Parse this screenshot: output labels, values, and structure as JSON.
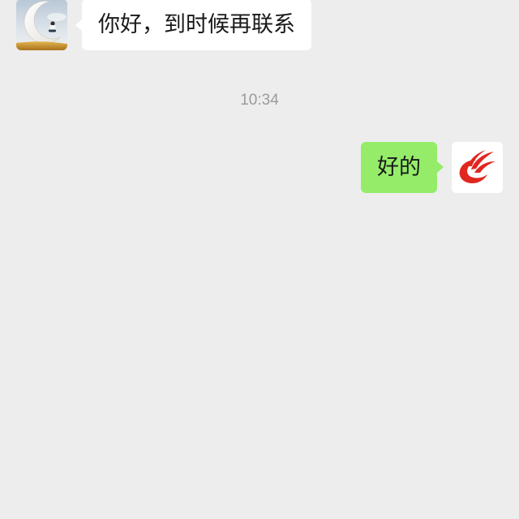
{
  "chat": {
    "incoming_message": {
      "text": "你好，到时候再联系",
      "avatar_icon": "crescent-moon-photo-icon"
    },
    "timestamp": "10:34",
    "outgoing_message": {
      "text": "好的",
      "avatar_icon": "phoenix-logo-icon"
    }
  },
  "colors": {
    "background": "#EDEDED",
    "incoming_bubble": "#FFFFFF",
    "outgoing_bubble": "#95EC69",
    "message_text": "#191919",
    "timestamp_text": "#9B9B9B",
    "logo_red": "#E0271F"
  }
}
